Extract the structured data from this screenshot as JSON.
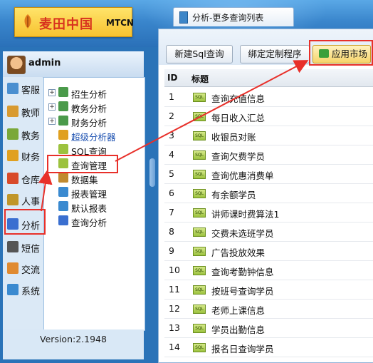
{
  "banner": {
    "logo_text": "麦田中国",
    "logo_sub": "MTCN"
  },
  "tab": {
    "label": "分析-更多查询列表"
  },
  "user": {
    "name": "admin"
  },
  "left_nav": [
    {
      "label": "客服",
      "icon": "customer-service-icon",
      "color": "#4a8fd0"
    },
    {
      "label": "教师",
      "icon": "teacher-icon",
      "color": "#d89a30"
    },
    {
      "label": "教务",
      "icon": "academic-icon",
      "color": "#7aa83a"
    },
    {
      "label": "财务",
      "icon": "finance-icon",
      "color": "#e0a020"
    },
    {
      "label": "仓库",
      "icon": "warehouse-icon",
      "color": "#d84a2a"
    },
    {
      "label": "人事",
      "icon": "hr-icon",
      "color": "#c0962a"
    },
    {
      "label": "分析",
      "icon": "analysis-chart-icon",
      "color": "#3a6fd0"
    },
    {
      "label": "短信",
      "icon": "sms-icon",
      "color": "#555555"
    },
    {
      "label": "交流",
      "icon": "chat-icon",
      "color": "#e08a30"
    },
    {
      "label": "系统",
      "icon": "system-icon",
      "color": "#3a8ad0"
    }
  ],
  "tree": [
    {
      "label": "招生分析",
      "expandable": true,
      "icon": "search-analysis-icon"
    },
    {
      "label": "教务分析",
      "expandable": true,
      "icon": "search-analysis-icon"
    },
    {
      "label": "财务分析",
      "expandable": true,
      "icon": "search-analysis-icon"
    },
    {
      "label": "超级分析器",
      "expandable": false,
      "icon": "super-analyzer-icon"
    },
    {
      "label": "SQL查询",
      "expandable": false,
      "icon": "sql-icon"
    },
    {
      "label": "查询管理",
      "expandable": false,
      "icon": "query-manage-icon"
    },
    {
      "label": "数据集",
      "expandable": false,
      "icon": "xml-dataset-icon"
    },
    {
      "label": "报表管理",
      "expandable": false,
      "icon": "report-icon"
    },
    {
      "label": "默认报表",
      "expandable": false,
      "icon": "default-report-icon"
    },
    {
      "label": "查询分析",
      "expandable": false,
      "icon": "query-analysis-icon"
    }
  ],
  "version": "Version:2.1948",
  "toolbar": {
    "new_sql": "新建Sql查询",
    "bind_program": "绑定定制程序",
    "app_market": "应用市场"
  },
  "table": {
    "columns": [
      "ID",
      "标题"
    ],
    "rows": [
      {
        "id": "1",
        "title": "查询充值信息"
      },
      {
        "id": "2",
        "title": "每日收入汇总"
      },
      {
        "id": "3",
        "title": "收银员对账"
      },
      {
        "id": "4",
        "title": "查询欠费学员"
      },
      {
        "id": "5",
        "title": "查询优惠消费单"
      },
      {
        "id": "6",
        "title": "有余额学员"
      },
      {
        "id": "7",
        "title": "讲师课时费算法1"
      },
      {
        "id": "8",
        "title": "交费未选班学员"
      },
      {
        "id": "9",
        "title": "广告投放效果"
      },
      {
        "id": "10",
        "title": "查询考勤钟信息"
      },
      {
        "id": "11",
        "title": "按班号查询学员"
      },
      {
        "id": "12",
        "title": "老师上课信息"
      },
      {
        "id": "13",
        "title": "学员出勤信息"
      },
      {
        "id": "14",
        "title": "报名日查询学员"
      }
    ]
  },
  "colors": {
    "annotation_red": "#e8302a",
    "banner_blue": "#2a73b8"
  }
}
